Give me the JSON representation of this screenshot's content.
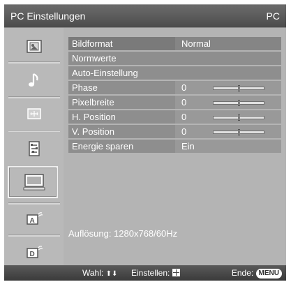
{
  "header": {
    "title": "PC Einstellungen",
    "source": "PC"
  },
  "sidebar": {
    "items": [
      {
        "icon": "picture-icon",
        "selected": false
      },
      {
        "icon": "music-note-icon",
        "selected": false
      },
      {
        "icon": "screen-setup-icon",
        "selected": false
      },
      {
        "icon": "settings-list-icon",
        "selected": false
      },
      {
        "icon": "pc-monitor-icon",
        "selected": true
      },
      {
        "icon": "analog-antenna-icon",
        "selected": false
      },
      {
        "icon": "digital-antenna-icon",
        "selected": false
      }
    ]
  },
  "menu": {
    "rows": [
      {
        "label": "Bildformat",
        "value": "Normal"
      },
      {
        "label": "Normwerte",
        "value": ""
      },
      {
        "label": "Auto-Einstellung",
        "value": ""
      },
      {
        "label": "Phase",
        "value": "0",
        "slider_level": 0.5
      },
      {
        "label": "Pixelbreite",
        "value": "0",
        "slider_level": 0.5
      },
      {
        "label": "H. Position",
        "value": "0",
        "slider_level": 0.5
      },
      {
        "label": "V. Position",
        "value": "0",
        "slider_level": 0.5
      },
      {
        "label": "Energie sparen",
        "value": "Ein"
      }
    ],
    "resolution": "Auflösung: 1280x768/60Hz"
  },
  "footer": {
    "wahl_label": "Wahl:",
    "wahl_symbols": "⬆⬇",
    "einstellen_label": "Einstellen:",
    "ende_label": "Ende:",
    "menu_button": "MENU"
  }
}
